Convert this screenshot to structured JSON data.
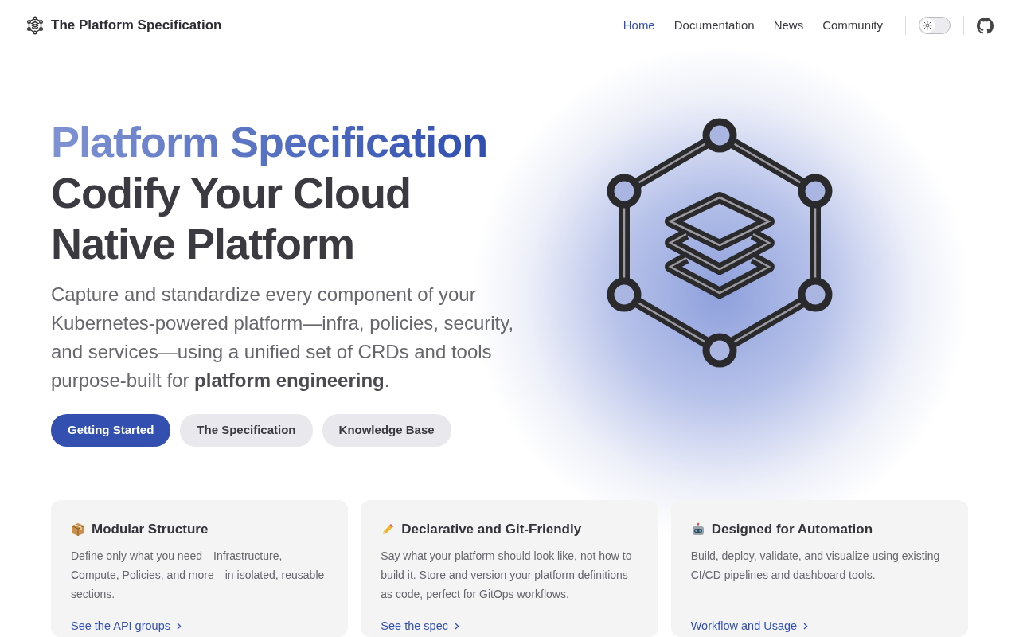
{
  "brand": {
    "title": "The Platform Specification"
  },
  "nav": [
    {
      "label": "Home",
      "selected": true
    },
    {
      "label": "Documentation",
      "selected": false
    },
    {
      "label": "News",
      "selected": false
    },
    {
      "label": "Community",
      "selected": false
    }
  ],
  "theme_toggle": {
    "on": false
  },
  "hero": {
    "highlight": "Platform Specification",
    "title": "Codify Your Cloud Native Platform",
    "lead": "Capture and standardize every component of your Kubernetes-powered platform—infra, policies, security, and services—using a unified set of CRDs and tools purpose-built for **platform engineering**.",
    "buttons": [
      {
        "label": "Getting Started",
        "kind": "primary"
      },
      {
        "label": "The Specification",
        "kind": "secondary"
      },
      {
        "label": "Knowledge Base",
        "kind": "secondary"
      }
    ]
  },
  "features": [
    {
      "kind": "box",
      "title": "Modular Structure",
      "text": "Define only what you need—Infrastructure, Compute, Policies, and more—in isolated, reusable sections.",
      "link": "See the API groups"
    },
    {
      "kind": "pencil",
      "title": "Declarative and Git-Friendly",
      "text": "Say what your platform should look like, not how to build it. Store and version your platform definitions as code, perfect for GitOps workflows.",
      "link": "See the spec"
    },
    {
      "kind": "robot",
      "title": "Designed for Automation",
      "text": "Build, deploy, validate, and visualize using existing CI/CD pipelines and dashboard tools.",
      "link": "Workflow and Usage"
    }
  ]
}
